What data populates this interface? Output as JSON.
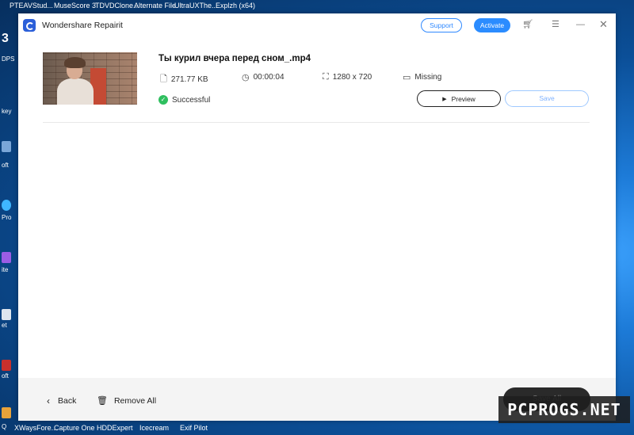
{
  "desktop": {
    "top_labels": [
      "PTEAVStud...",
      "MuseScore 3",
      "TDVDClone...",
      "Alternate File",
      "UltraUXThe...",
      "Explzh (x64)"
    ],
    "bottom_labels": [
      "XWaysFore...",
      "Capture One",
      "HDDExpert",
      "Icecream",
      "Exif Pilot"
    ],
    "left_labels": [
      "3",
      "DPS",
      "key",
      "oft",
      "Pro",
      "ite",
      "et",
      "oft",
      "Q"
    ]
  },
  "titlebar": {
    "title": "Wondershare Repairit",
    "support_label": "Support",
    "activate_label": "Activate",
    "icons": [
      "cart-icon",
      "menu-icon",
      "minimize-icon",
      "close-icon"
    ]
  },
  "file": {
    "name": "Ты курил вчера перед сном_.mp4",
    "size": "271.77  KB",
    "duration": "00:00:04",
    "resolution": "1280 x 720",
    "audio_status": "Missing",
    "repair_status": "Successful",
    "preview_label": "Preview",
    "save_label": "Save"
  },
  "footer": {
    "back_label": "Back",
    "remove_all_label": "Remove All",
    "save_all_label": "Save All"
  },
  "watermark": {
    "text": "PCPROGS.NET"
  },
  "colors": {
    "accent": "#2b8cff",
    "success": "#2fbf5f"
  }
}
